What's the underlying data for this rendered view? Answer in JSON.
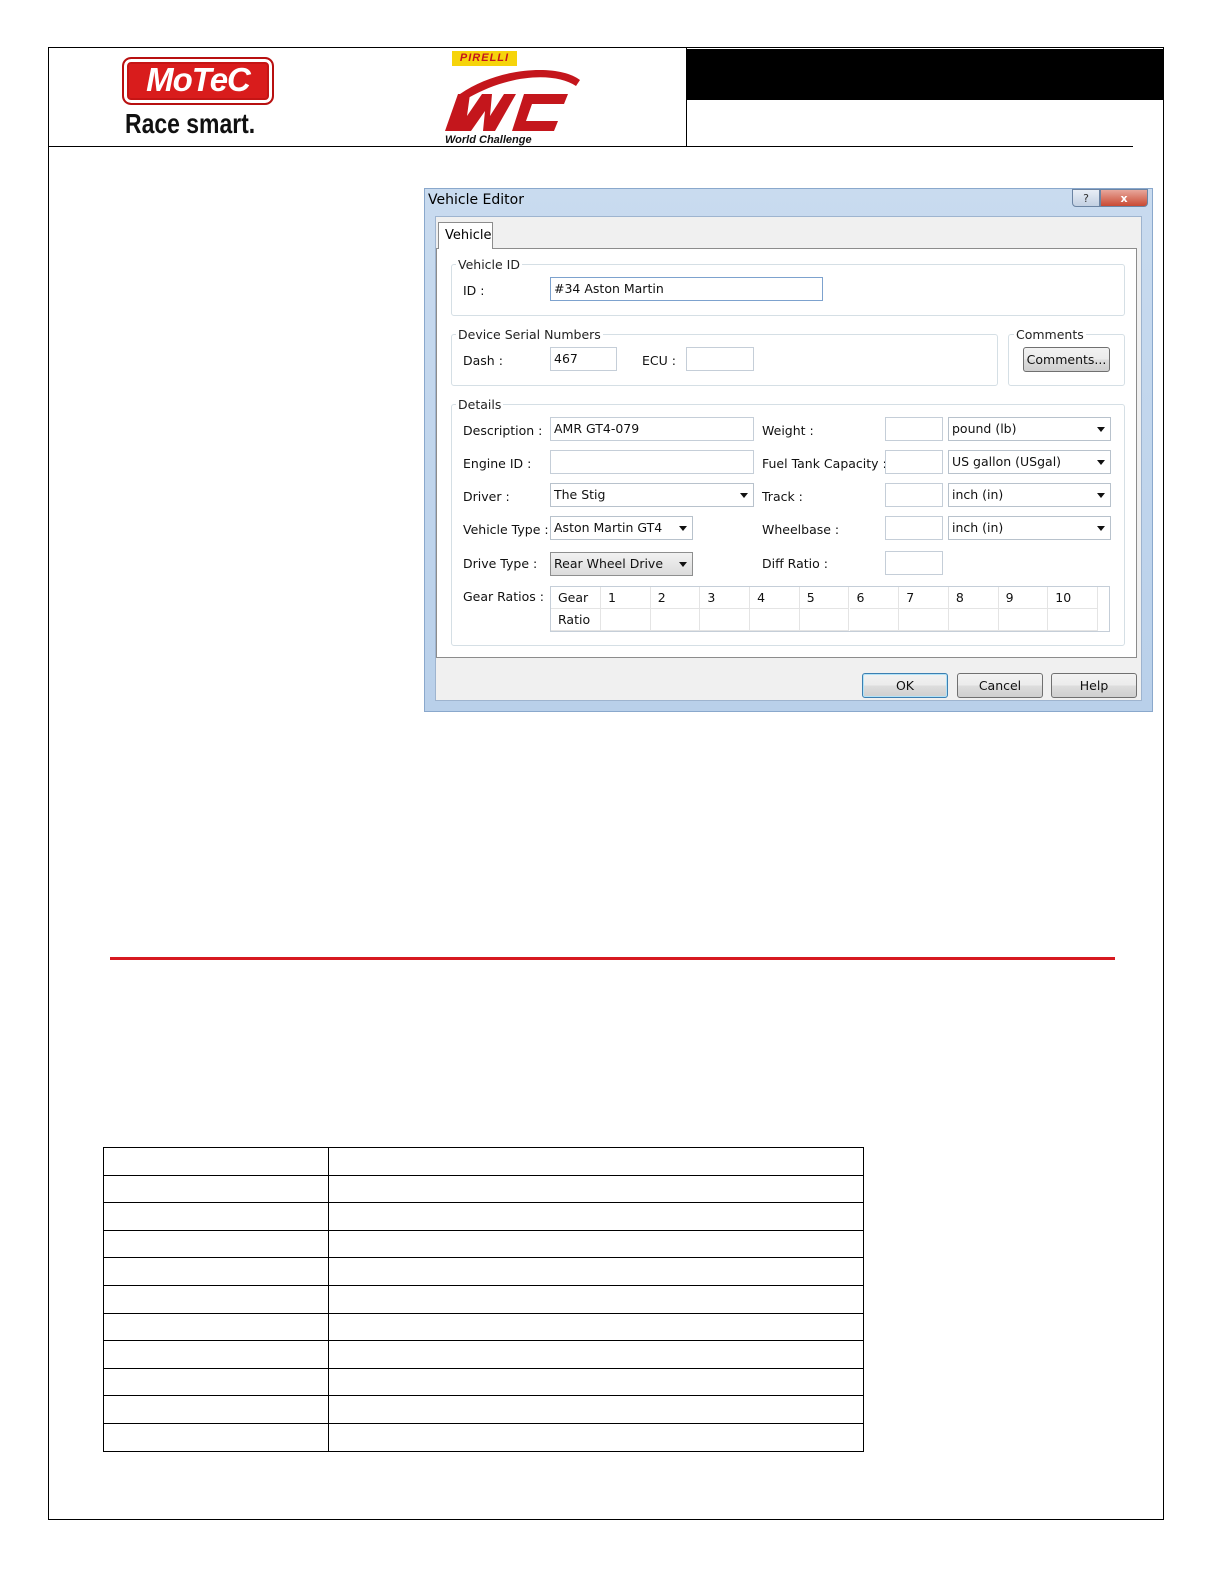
{
  "header": {
    "motec_logo_text": "MoTeC",
    "motec_tagline": "Race smart.",
    "pirelli_text": "PIRELLI",
    "wc_logo_text": "WC",
    "wc_logo_subtext": "World Challenge"
  },
  "dialog": {
    "title": "Vehicle Editor",
    "help_button": "?",
    "close_button": "x",
    "tab_label": "Vehicle",
    "vehicle_id_group": "Vehicle ID",
    "id_label": "ID :",
    "id_value": "#34 Aston Martin",
    "serial_group": "Device Serial Numbers",
    "dash_label": "Dash :",
    "dash_value": "467",
    "ecu_label": "ECU :",
    "ecu_value": "",
    "comments_group": "Comments",
    "comments_button": "Comments...",
    "details_group": "Details",
    "description_label": "Description :",
    "description_value": "AMR GT4-079",
    "engine_id_label": "Engine ID :",
    "engine_id_value": "",
    "driver_label": "Driver :",
    "driver_value": "The Stig",
    "vehicle_type_label": "Vehicle Type :",
    "vehicle_type_value": "Aston Martin GT4",
    "drive_type_label": "Drive Type :",
    "drive_type_value": "Rear Wheel Drive",
    "gear_ratios_label": "Gear Ratios :",
    "weight_label": "Weight :",
    "weight_value": "",
    "weight_unit": "pound (lb)",
    "fuel_tank_label": "Fuel Tank Capacity :",
    "fuel_tank_value": "",
    "fuel_tank_unit": "US gallon (USgal)",
    "track_label": "Track :",
    "track_value": "",
    "track_unit": "inch (in)",
    "wheelbase_label": "Wheelbase :",
    "wheelbase_value": "",
    "wheelbase_unit": "inch (in)",
    "diff_ratio_label": "Diff Ratio :",
    "diff_ratio_value": "",
    "gear_table": {
      "row_headers": [
        "Gear",
        "Ratio"
      ],
      "columns": [
        "1",
        "2",
        "3",
        "4",
        "5",
        "6",
        "7",
        "8",
        "9",
        "10"
      ]
    },
    "ok_button": "OK",
    "cancel_button": "Cancel",
    "help_text_button": "Help"
  },
  "colors": {
    "motec_red": "#d91c1c",
    "rule_red": "#d71920",
    "pirelli_yellow": "#f6d40b"
  }
}
